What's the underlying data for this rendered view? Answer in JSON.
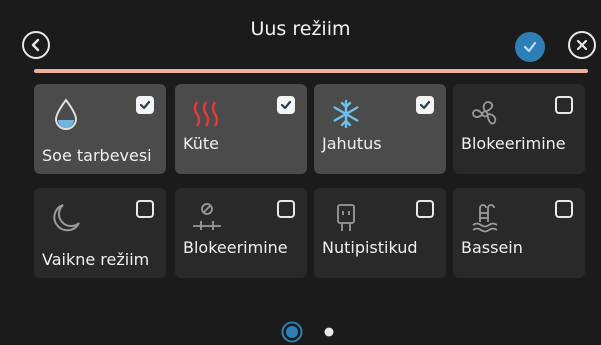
{
  "header": {
    "title": "Uus režiim",
    "back_icon": "back-arrow-icon",
    "confirm_icon": "check-icon",
    "close_icon": "close-icon",
    "accent_color": "#e9b19e",
    "confirm_color": "#2f7fb7"
  },
  "tiles": [
    {
      "label": "Soe tarbevesi",
      "icon": "water-drop-icon",
      "checked": true
    },
    {
      "label": "Küte",
      "icon": "heat-waves-icon",
      "checked": true
    },
    {
      "label": "Jahutus",
      "icon": "snowflake-icon",
      "checked": true
    },
    {
      "label": "Blokeerimine",
      "icon": "fan-icon",
      "checked": false
    },
    {
      "label": "Vaikne režiim",
      "icon": "moon-icon",
      "checked": false
    },
    {
      "label": "Blokeerimine",
      "icon": "blocked-heater-icon",
      "checked": false
    },
    {
      "label": "Nutipistikud",
      "icon": "smart-plug-icon",
      "checked": false
    },
    {
      "label": "Bassein",
      "icon": "pool-icon",
      "checked": false
    }
  ],
  "pagination": {
    "total": 2,
    "current": 1
  }
}
